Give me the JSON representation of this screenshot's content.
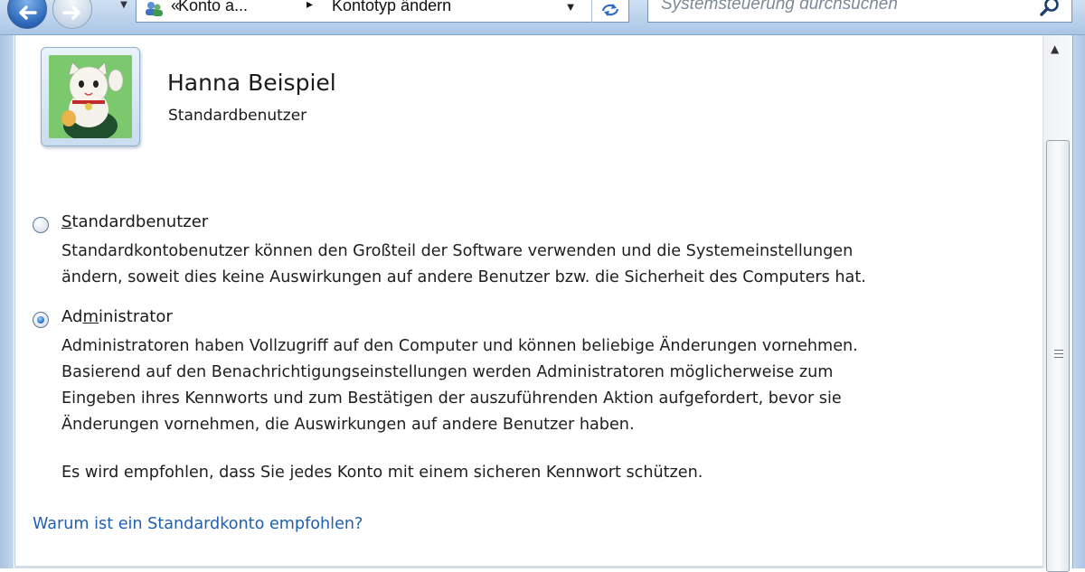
{
  "address_bar": {
    "separator": "«",
    "crumb_1": "Konto a...",
    "crumb_separator": "▸",
    "crumb_2": "Kontotyp ändern"
  },
  "search": {
    "placeholder": "Systemsteuerung durchsuchen"
  },
  "user": {
    "name": "Hanna Beispiel",
    "account_type": "Standardbenutzer"
  },
  "options": {
    "standard": {
      "label_accel": "S",
      "label_rest": "tandardbenutzer",
      "selected": false,
      "description_lines": [
        "Standardkontobenutzer können den Großteil der Software verwenden und die Systemeinstellungen",
        "ändern, soweit dies keine Auswirkungen auf andere Benutzer bzw. die Sicherheit des Computers hat."
      ]
    },
    "admin": {
      "label_pre": "Ad",
      "label_accel": "m",
      "label_rest": "inistrator",
      "selected": true,
      "description_lines": [
        "Administratoren haben Vollzugriff auf den Computer und können beliebige Änderungen vornehmen.",
        "Basierend auf den Benachrichtigungseinstellungen werden Administratoren möglicherweise zum",
        "Eingeben ihres Kennworts und zum Bestätigen der auszuführenden Aktion aufgefordert, bevor sie",
        "Änderungen vornehmen, die Auswirkungen auf andere Benutzer haben."
      ]
    }
  },
  "recommendation": "Es wird empfohlen, dass Sie jedes Konto mit einem sicheren Kennwort schützen.",
  "link": "Warum ist ein Standardkonto empfohlen?",
  "colors": {
    "link": "#1f5fb0",
    "frame": "#b9d1ec"
  }
}
